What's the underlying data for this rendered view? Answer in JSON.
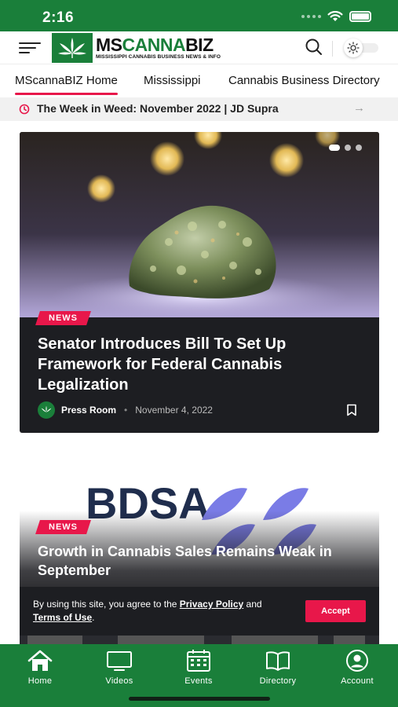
{
  "status_bar": {
    "time": "2:16"
  },
  "header": {
    "logo_main_prefix": "MS",
    "logo_main_accent": "CANNA",
    "logo_main_suffix": "BIZ",
    "logo_sub": "MISSISSIPPI CANNABIS BUSINESS NEWS & INFO",
    "brand_color": "#1a7f3a"
  },
  "nav": {
    "items": [
      {
        "label": "MScannaBIZ Home",
        "active": true
      },
      {
        "label": "Mississippi",
        "active": false
      },
      {
        "label": "Cannabis Business Directory",
        "active": false
      }
    ]
  },
  "ticker": {
    "text": "The Week in Weed: November 2022 | JD Supra"
  },
  "articles": [
    {
      "badge": "NEWS",
      "title": "Senator Introduces Bill To Set Up Framework for Federal Cannabis Legalization",
      "author": "Press Room",
      "date": "November 4, 2022",
      "image": "cannabis-bud-photo"
    },
    {
      "badge": "NEWS",
      "title": "Growth in Cannabis Sales Remains Weak in September",
      "image_text": "BDSA"
    }
  ],
  "cookie": {
    "prefix": "By using this site, you agree to the",
    "privacy_link": "Privacy Policy",
    "and": "and",
    "terms_link": "Terms of Use",
    "suffix": ".",
    "accept_label": "Accept"
  },
  "bottom_nav": {
    "tabs": [
      {
        "label": "Home",
        "icon": "home-icon"
      },
      {
        "label": "Videos",
        "icon": "tv-icon"
      },
      {
        "label": "Events",
        "icon": "calendar-icon"
      },
      {
        "label": "Directory",
        "icon": "book-icon"
      },
      {
        "label": "Account",
        "icon": "account-icon"
      }
    ]
  },
  "colors": {
    "accent": "#e8174a",
    "brand": "#1a7f3a",
    "card": "#1d1e22"
  }
}
